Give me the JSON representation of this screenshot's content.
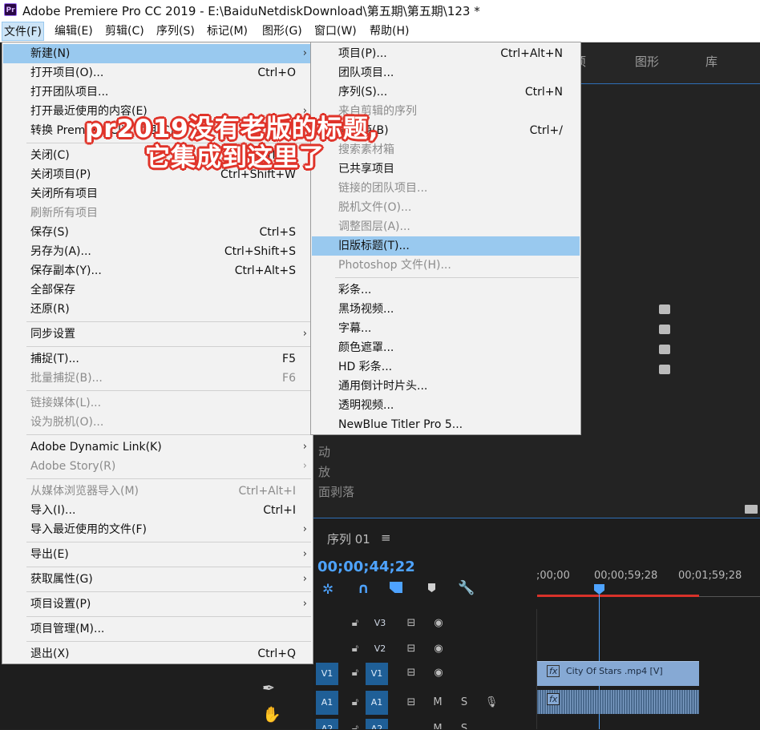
{
  "window": {
    "app_icon": "Pr",
    "title": "Adobe Premiere Pro CC 2019 - E:\\BaiduNetdiskDownload\\第五期\\第五期\\123 *"
  },
  "menubar": [
    "文件(F)",
    "编辑(E)",
    "剪辑(C)",
    "序列(S)",
    "标记(M)",
    "图形(G)",
    "窗口(W)",
    "帮助(H)"
  ],
  "file_menu": [
    {
      "label": "新建(N)",
      "shortcut": "",
      "submenu": true,
      "disabled": false,
      "highlight": true
    },
    {
      "label": "打开项目(O)...",
      "shortcut": "Ctrl+O"
    },
    {
      "label": "打开团队项目..."
    },
    {
      "label": "打开最近使用的内容(E)",
      "submenu": true
    },
    {
      "label": "转换 Premiere Clip 项目(C)...",
      "shortcut": ""
    },
    {
      "sep": true
    },
    {
      "label": "关闭(C)",
      "shortcut": "Ctrl+W"
    },
    {
      "label": "关闭项目(P)",
      "shortcut": "Ctrl+Shift+W"
    },
    {
      "label": "关闭所有项目"
    },
    {
      "label": "刷新所有项目",
      "disabled": true
    },
    {
      "label": "保存(S)",
      "shortcut": "Ctrl+S"
    },
    {
      "label": "另存为(A)...",
      "shortcut": "Ctrl+Shift+S"
    },
    {
      "label": "保存副本(Y)...",
      "shortcut": "Ctrl+Alt+S"
    },
    {
      "label": "全部保存"
    },
    {
      "label": "还原(R)"
    },
    {
      "sep": true
    },
    {
      "label": "同步设置",
      "submenu": true
    },
    {
      "sep": true
    },
    {
      "label": "捕捉(T)...",
      "shortcut": "F5"
    },
    {
      "label": "批量捕捉(B)...",
      "shortcut": "F6",
      "disabled": true
    },
    {
      "sep": true
    },
    {
      "label": "链接媒体(L)...",
      "disabled": true
    },
    {
      "label": "设为脱机(O)...",
      "disabled": true
    },
    {
      "sep": true
    },
    {
      "label": "Adobe Dynamic Link(K)",
      "submenu": true
    },
    {
      "label": "Adobe Story(R)",
      "submenu": true,
      "disabled": true
    },
    {
      "sep": true
    },
    {
      "label": "从媒体浏览器导入(M)",
      "shortcut": "Ctrl+Alt+I",
      "disabled": true
    },
    {
      "label": "导入(I)...",
      "shortcut": "Ctrl+I"
    },
    {
      "label": "导入最近使用的文件(F)",
      "submenu": true
    },
    {
      "sep": true
    },
    {
      "label": "导出(E)",
      "submenu": true
    },
    {
      "sep": true
    },
    {
      "label": "获取属性(G)",
      "submenu": true
    },
    {
      "sep": true
    },
    {
      "label": "项目设置(P)",
      "submenu": true
    },
    {
      "sep": true
    },
    {
      "label": "项目管理(M)..."
    },
    {
      "sep": true
    },
    {
      "label": "退出(X)",
      "shortcut": "Ctrl+Q"
    }
  ],
  "new_submenu": [
    {
      "label": "项目(P)...",
      "shortcut": "Ctrl+Alt+N"
    },
    {
      "label": "团队项目..."
    },
    {
      "label": "序列(S)...",
      "shortcut": "Ctrl+N"
    },
    {
      "label": "来自剪辑的序列",
      "disabled": true
    },
    {
      "label": "素材箱(B)",
      "shortcut": "Ctrl+/"
    },
    {
      "label": "搜索素材箱",
      "disabled": true
    },
    {
      "label": "已共享项目"
    },
    {
      "label": "链接的团队项目...",
      "disabled": true
    },
    {
      "label": "脱机文件(O)...",
      "disabled": true
    },
    {
      "label": "调整图层(A)...",
      "disabled": true
    },
    {
      "label": "旧版标题(T)...",
      "highlight": true
    },
    {
      "label": "Photoshop 文件(H)...",
      "disabled": true
    },
    {
      "sep": true
    },
    {
      "label": "彩条..."
    },
    {
      "label": "黑场视频..."
    },
    {
      "label": "字幕..."
    },
    {
      "label": "颜色遮罩..."
    },
    {
      "label": "HD 彩条..."
    },
    {
      "label": "通用倒计时片头..."
    },
    {
      "label": "透明视频..."
    },
    {
      "label": "NewBlue Titler Pro 5..."
    }
  ],
  "annotation": {
    "line1": "pr2019没有老版的标题,",
    "line2": "它集成到这里了"
  },
  "background": {
    "tab_partial": "项",
    "tab_graphics": "图形",
    "tab_library": "库",
    "effect_items": [
      "动",
      "放",
      "面剥落"
    ],
    "effect_item_0_prefix": "动",
    "sequence_tab": "序列 01",
    "sequence_menu_icon": "≡",
    "timecode": "00;00;44;22",
    "ruler": [
      "00;00",
      "00;00;59;28",
      "00;01;59;28"
    ],
    "ruler_first": ";00;00",
    "tracks": [
      {
        "left": "",
        "name": "V3"
      },
      {
        "left": "",
        "name": "V2"
      },
      {
        "left": "V1",
        "name": "V1"
      },
      {
        "left": "A1",
        "name": "A1",
        "m": "M",
        "s": "S"
      },
      {
        "left": "A2",
        "name": "A2",
        "m": "M",
        "s": "S"
      }
    ],
    "clip_fx": "fx",
    "clip_label": "City Of Stars .mp4 [V]"
  }
}
